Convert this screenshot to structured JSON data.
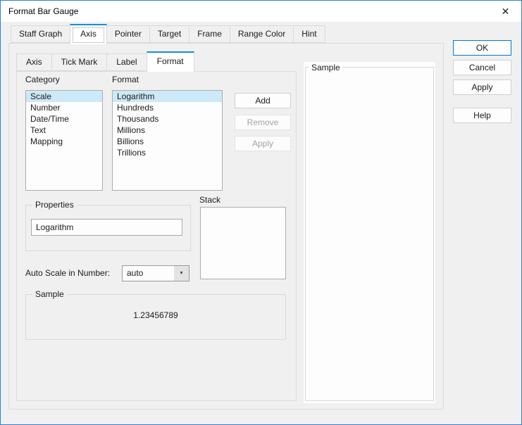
{
  "window": {
    "title": "Format Bar Gauge"
  },
  "icons": {
    "close": "✕",
    "dropdown_arrow": "▼"
  },
  "main_tabs": {
    "items": [
      "Staff Graph",
      "Axis",
      "Pointer",
      "Target",
      "Frame",
      "Range Color",
      "Hint"
    ],
    "selected": "Axis"
  },
  "sub_tabs": {
    "items": [
      "Axis",
      "Tick Mark",
      "Label",
      "Format"
    ],
    "selected": "Format"
  },
  "format_tab": {
    "category_list": {
      "label": "Category",
      "items": [
        "Scale",
        "Number",
        "Date/Time",
        "Text",
        "Mapping"
      ],
      "selected": "Scale"
    },
    "format_list": {
      "label": "Format",
      "items": [
        "Logarithm",
        "Hundreds",
        "Thousands",
        "Millions",
        "Billions",
        "Trillions"
      ],
      "selected": "Logarithm"
    },
    "list_buttons": {
      "add": "Add",
      "remove": "Remove",
      "apply": "Apply"
    },
    "properties_group": {
      "label": "Properties",
      "input_value": "Logarithm"
    },
    "stack": {
      "label": "Stack"
    },
    "auto_scale": {
      "label": "Auto Scale in Number:",
      "selected_value": "auto"
    },
    "sample_group": {
      "label": "Sample",
      "value": "1.23456789"
    }
  },
  "right_panel": {
    "sample_label": "Sample"
  },
  "action_buttons": {
    "ok": "OK",
    "cancel": "Cancel",
    "apply": "Apply",
    "help": "Help"
  },
  "colors": {
    "accent": "#0078d7",
    "selection_highlight": "#cde8f6",
    "dialog_background": "#f0f0f0",
    "dialog_border": "#2f7fd6"
  }
}
